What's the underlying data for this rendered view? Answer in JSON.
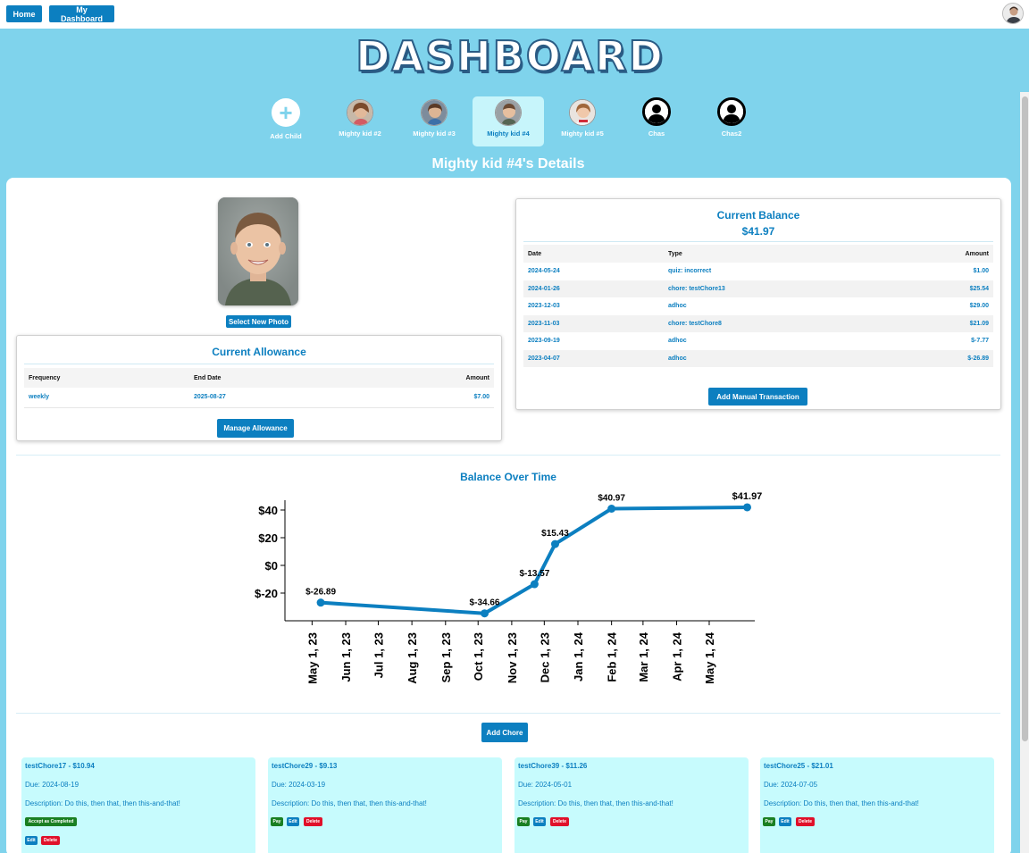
{
  "nav": {
    "home": "Home",
    "my_dashboard": "My Dashboard",
    "avatar_icon": "user-avatar-icon"
  },
  "title": "DASHBOARD",
  "kids": [
    {
      "label": "Add Child",
      "icon": "plus-icon"
    },
    {
      "label": "Mighty kid #2",
      "icon": "child-photo"
    },
    {
      "label": "Mighty kid #3",
      "icon": "child-photo"
    },
    {
      "label": "Mighty kid #4",
      "icon": "child-photo",
      "selected": true
    },
    {
      "label": "Mighty kid #5",
      "icon": "child-photo"
    },
    {
      "label": "Chas",
      "icon": "person-silhouette-icon"
    },
    {
      "label": "Chas2",
      "icon": "person-silhouette-icon"
    }
  ],
  "details_title": "Mighty kid #4's Details",
  "photo_button": "Select New Photo",
  "allowance": {
    "title": "Current Allowance",
    "headers": [
      "Frequency",
      "End Date",
      "Amount"
    ],
    "row": [
      "weekly",
      "2025-08-27",
      "$7.00"
    ],
    "button": "Manage Allowance"
  },
  "balance": {
    "title": "Current Balance",
    "amount": "$41.97",
    "headers": [
      "Date",
      "Type",
      "Amount"
    ],
    "rows": [
      [
        "2024-05-24",
        "quiz: incorrect",
        "$1.00"
      ],
      [
        "2024-01-26",
        "chore: testChore13",
        "$25.54"
      ],
      [
        "2023-12-03",
        "adhoc",
        "$29.00"
      ],
      [
        "2023-11-03",
        "chore: testChore8",
        "$21.09"
      ],
      [
        "2023-09-19",
        "adhoc",
        "$-7.77"
      ],
      [
        "2023-04-07",
        "adhoc",
        "$-26.89"
      ]
    ],
    "button": "Add Manual Transaction"
  },
  "chart_data": {
    "type": "line",
    "title": "Balance Over Time",
    "xlabel": "",
    "ylabel": "",
    "x": [
      "2023-05-09",
      "2023-10-07",
      "2023-11-22",
      "2023-12-11",
      "2024-02-01",
      "2024-06-05"
    ],
    "series": [
      {
        "values": [
          -26.89,
          -34.66,
          -13.57,
          15.43,
          40.97,
          41.97
        ]
      }
    ],
    "data_labels": [
      "$-26.89",
      "$-34.66",
      "$-13.57",
      "$15.43",
      "$40.97",
      "$41.97"
    ],
    "x_ticks": [
      "May 1, 23",
      "Jun 1, 23",
      "Jul 1, 23",
      "Aug 1, 23",
      "Sep 1, 23",
      "Oct 1, 23",
      "Nov 1, 23",
      "Dec 1, 23",
      "Jan 1, 24",
      "Feb 1, 24",
      "Mar 1, 24",
      "Apr 1, 24",
      "May 1, 24"
    ],
    "y_ticks": [
      "$40",
      "$20",
      "$0",
      "$-20"
    ],
    "ylim": [
      -40,
      47
    ],
    "grid": false,
    "color": "#0c7fc0"
  },
  "add_chore": "Add Chore",
  "chores": [
    {
      "title": "testChore17 - $10.94",
      "due": "Due: 2024-08-19",
      "desc": "Description: Do this, then that, then this-and-that!",
      "buttons": [
        "Accept as Completed",
        "Edit",
        "Delete"
      ]
    },
    {
      "title": "testChore29 - $9.13",
      "due": "Due: 2024-03-19",
      "desc": "Description: Do this, then that, then this-and-that!",
      "buttons": [
        "Pay",
        "Edit",
        "Delete"
      ]
    },
    {
      "title": "testChore39 - $11.26",
      "due": "Due: 2024-05-01",
      "desc": "Description: Do this, then that, then this-and-that!",
      "buttons": [
        "Pay",
        "Edit",
        "Delete"
      ]
    },
    {
      "title": "testChore25 - $21.01",
      "due": "Due: 2024-07-05",
      "desc": "Description: Do this, then that, then this-and-that!",
      "buttons": [
        "Pay",
        "Edit",
        "Delete"
      ]
    }
  ]
}
